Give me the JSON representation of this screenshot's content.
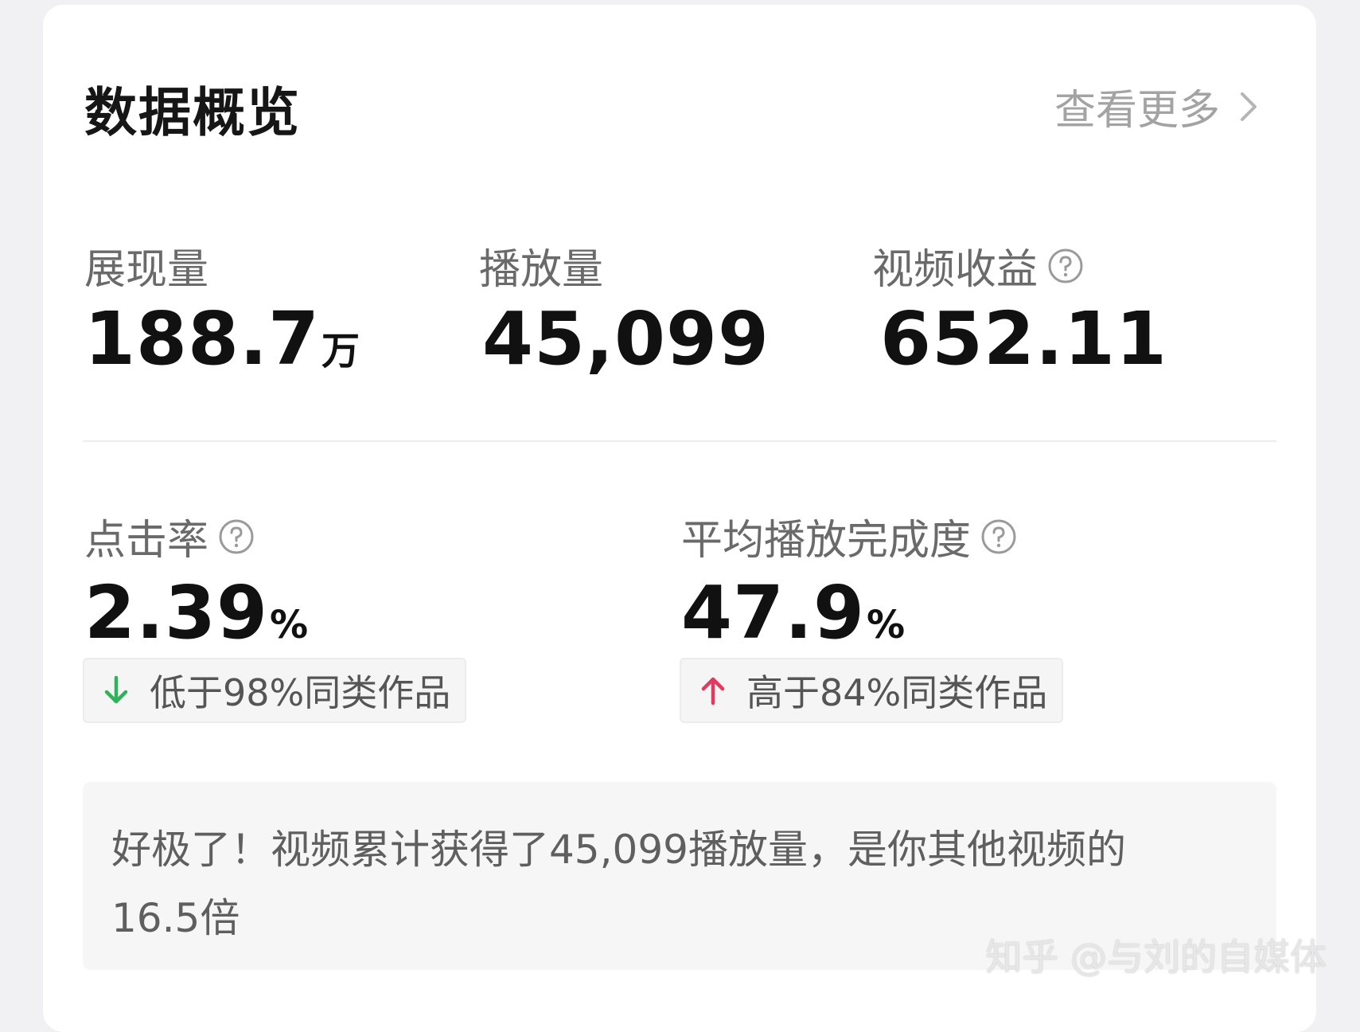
{
  "header": {
    "title": "数据概览",
    "view_more_label": "查看更多"
  },
  "metrics_top": [
    {
      "label": "展现量",
      "value": "188.7",
      "unit": "万",
      "has_help": false
    },
    {
      "label": "播放量",
      "value": "45,099",
      "unit": "",
      "has_help": false
    },
    {
      "label": "视频收益",
      "value": "652.11",
      "unit": "",
      "has_help": true
    }
  ],
  "metrics_bottom": [
    {
      "label": "点击率",
      "value": "2.39",
      "unit": "%",
      "has_help": true,
      "comparison": {
        "direction": "down",
        "text": "低于98%同类作品",
        "color": "#2fb35a"
      }
    },
    {
      "label": "平均播放完成度",
      "value": "47.9",
      "unit": "%",
      "has_help": true,
      "comparison": {
        "direction": "up",
        "text": "高于84%同类作品",
        "color": "#e23a5f"
      }
    }
  ],
  "summary": {
    "line1": "好极了！视频累计获得了45,099播放量，是你其他视频的",
    "line2": "16.5倍"
  },
  "watermark": "知乎 @与刘的自媒体",
  "colors": {
    "background": "#f1f1f3",
    "card": "#ffffff",
    "title": "#161616",
    "label": "#6a6a6a",
    "muted": "#a3a3a3",
    "down": "#2fb35a",
    "up": "#e23a5f"
  },
  "icons": {
    "help": "question-circle-icon",
    "view_more": "chevron-right-icon",
    "down": "arrow-down-icon",
    "up": "arrow-up-icon"
  }
}
